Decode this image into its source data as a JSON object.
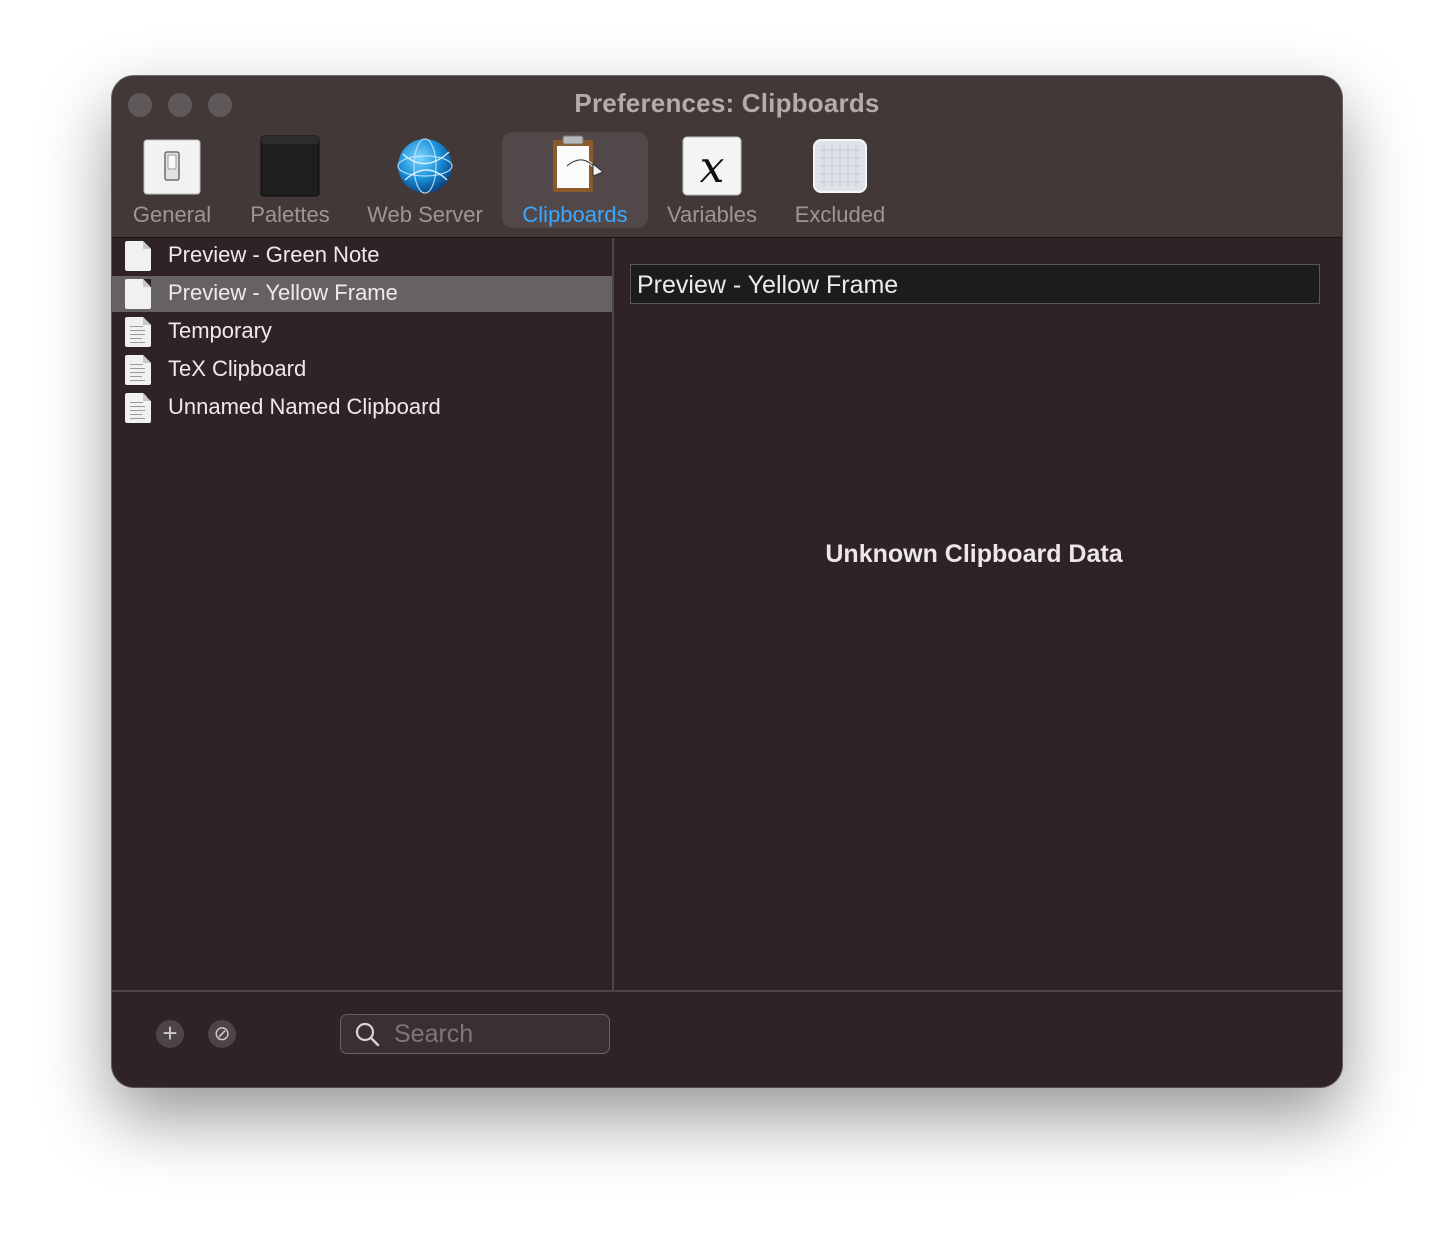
{
  "window": {
    "title": "Preferences: Clipboards"
  },
  "toolbar": {
    "tabs": [
      {
        "label": "General",
        "icon": "switch-icon",
        "active": false
      },
      {
        "label": "Palettes",
        "icon": "palette-icon",
        "active": false
      },
      {
        "label": "Web Server",
        "icon": "globe-icon",
        "active": false
      },
      {
        "label": "Clipboards",
        "icon": "clipboard-icon",
        "active": true
      },
      {
        "label": "Variables",
        "icon": "variable-x-icon",
        "active": false
      },
      {
        "label": "Excluded",
        "icon": "excluded-grid-icon",
        "active": false
      }
    ]
  },
  "sidebar": {
    "items": [
      {
        "label": "Preview - Green Note",
        "icon": "blank-document-icon",
        "selected": false
      },
      {
        "label": "Preview - Yellow Frame",
        "icon": "blank-document-icon",
        "selected": true
      },
      {
        "label": "Temporary",
        "icon": "text-document-icon",
        "selected": false
      },
      {
        "label": "TeX Clipboard",
        "icon": "text-document-icon",
        "selected": false
      },
      {
        "label": "Unnamed Named Clipboard",
        "icon": "text-document-icon",
        "selected": false
      }
    ]
  },
  "detail": {
    "name_value": "Preview - Yellow Frame",
    "message": "Unknown Clipboard Data"
  },
  "footer": {
    "add_icon": "+",
    "delete_icon": "⊘",
    "search_placeholder": "Search"
  },
  "colors": {
    "accent": "#3aa8ff",
    "window_bg": "#2f2326",
    "titlebar_bg": "#433838",
    "selection_bg": "#676262"
  }
}
